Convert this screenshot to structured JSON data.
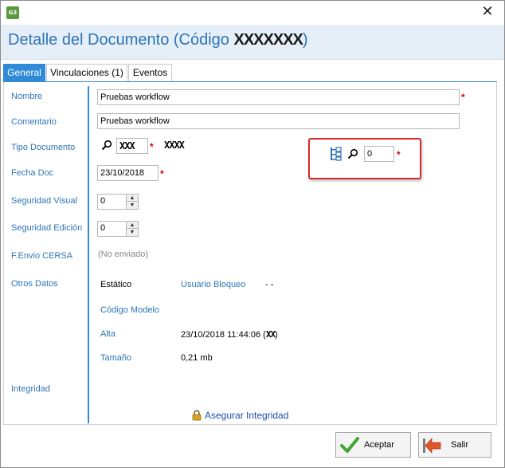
{
  "window": {
    "app_icon_text": "G3",
    "close_glyph": "✕",
    "title_prefix": "Detalle del Documento (Código ",
    "title_code": "XXXXXXX",
    "title_suffix": ")"
  },
  "tabs": [
    {
      "label": "General",
      "active": true
    },
    {
      "label": "Vinculaciones (1)",
      "active": false
    },
    {
      "label": "Eventos",
      "active": false
    }
  ],
  "labels": {
    "nombre": "Nombre",
    "comentario": "Comentario",
    "tipo_documento": "Tipo Documento",
    "fecha_doc": "Fecha Doc",
    "seguridad_visual": "Seguridad Visual",
    "seguridad_edicion": "Seguridad Edición",
    "f_envio_cersa": "F.Envio CERSA",
    "otros_datos": "Otros Datos",
    "integridad": "Integridad"
  },
  "fields": {
    "nombre_value": "Pruebas workflow",
    "comentario_value": "Pruebas workflow",
    "tipo_code": "XXX",
    "tipo_desc": "XXXX",
    "fecha_value": "23/10/2018",
    "seg_visual_value": "0",
    "seg_edicion_value": "0",
    "envio_value": "(No enviado)",
    "highlight_value": "0",
    "required_mark": "*"
  },
  "otros": {
    "estatico": "Estático",
    "usuario_bloqueo_label": "Usuario Bloqueo",
    "usuario_bloqueo_value": "- -",
    "codigo_modelo_label": "Código Modelo",
    "alta_label": "Alta",
    "alta_value_prefix": "23/10/2018 11:44:06 (",
    "alta_value_masked": "XX",
    "alta_value_suffix": ")",
    "tamano_label": "Tamaño",
    "tamano_value": "0,21 mb"
  },
  "actions": {
    "asegurar_integridad": "Asegurar Integridad",
    "aceptar": "Aceptar",
    "salir": "Salir"
  },
  "icons": {
    "search": "magnifier-icon",
    "tree": "tree-hierarchy-icon",
    "lock": "padlock-icon",
    "accept": "green-checkmark-icon",
    "exit": "exit-arrow-icon"
  },
  "colors": {
    "accent": "#2f8ad8",
    "label_blue": "#2e75b6",
    "header_bg": "#e6eef8",
    "required": "#d40000",
    "highlight_border": "#d42a2a"
  }
}
